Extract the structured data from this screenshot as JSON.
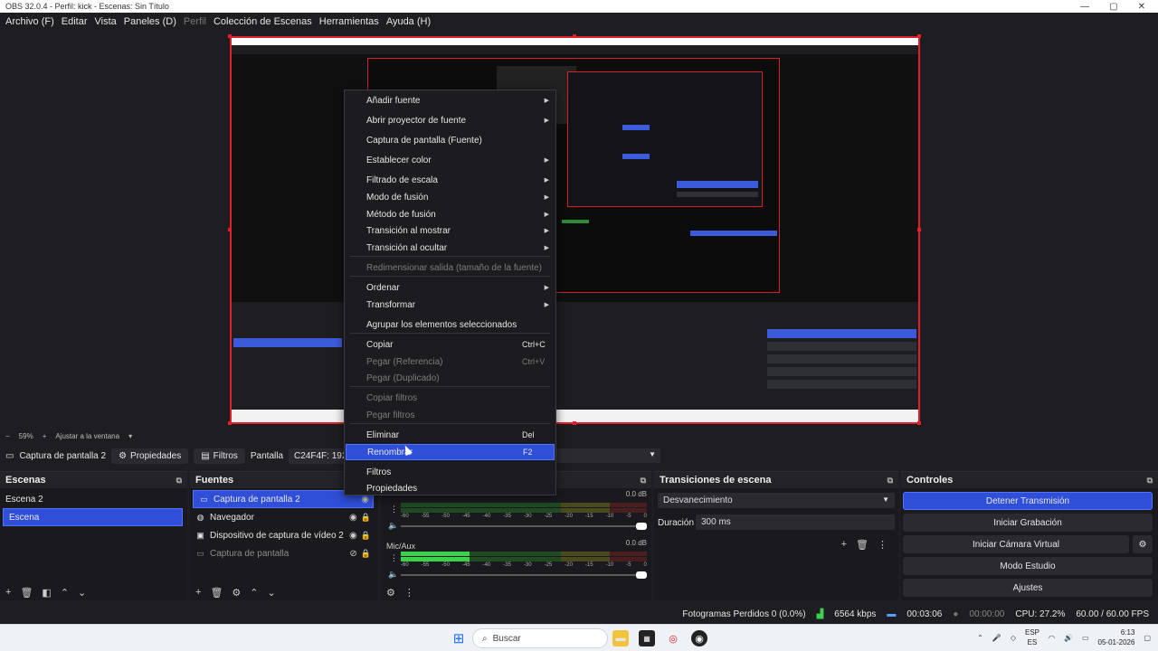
{
  "window": {
    "title": "OBS 32.0.4 - Perfil: kick - Escenas: Sin Título",
    "controls": [
      "—",
      "▢",
      "✕"
    ]
  },
  "menubar": {
    "items": [
      "Archivo (F)",
      "Editar",
      "Vista",
      "Paneles (D)",
      "Perfil",
      "Colección de Escenas",
      "Herramientas",
      "Ayuda (H)"
    ]
  },
  "zoom": {
    "minus": "−",
    "value": "59%",
    "plus": "+",
    "fit": "Ajustar a la ventana"
  },
  "source_bar": {
    "source_name": "Captura de pantalla 2",
    "properties": "Propiedades",
    "filters": "Filtros",
    "screen_label": "Pantalla",
    "screen_value": "C24F4F: 192"
  },
  "scenes": {
    "title": "Escenas",
    "items": [
      {
        "label": "Escena 2",
        "selected": false
      },
      {
        "label": "Escena",
        "selected": true
      }
    ]
  },
  "sources": {
    "title": "Fuentes",
    "items": [
      {
        "label": "Captura de pantalla 2",
        "selected": true
      },
      {
        "label": "Navegador",
        "selected": false
      },
      {
        "label": "Dispositivo de captura de vídeo 2",
        "selected": false
      },
      {
        "label": "Captura de pantalla",
        "selected": false,
        "dimmed": true
      }
    ]
  },
  "mixer": {
    "channels": [
      {
        "name": "",
        "db": "0.0 dB",
        "level": 0
      },
      {
        "name": "Mic/Aux",
        "db": "0.0 dB",
        "level": 0.28
      }
    ],
    "ticks": [
      "-60",
      "-55",
      "-50",
      "-45",
      "-40",
      "-35",
      "-30",
      "-25",
      "-20",
      "-15",
      "-10",
      "-5",
      "0"
    ]
  },
  "transitions": {
    "title": "Transiciones de escena",
    "selected": "Desvanecimiento",
    "duration_label": "Duración",
    "duration_value": "300 ms"
  },
  "controls": {
    "title": "Controles",
    "buttons": [
      "Detener Transmisión",
      "Iniciar Grabación",
      "Iniciar Cámara Virtual",
      "Modo Estudio",
      "Ajustes"
    ]
  },
  "status": {
    "dropped": "Fotogramas Perdidos 0 (0.0%)",
    "bitrate": "6564 kbps",
    "stream_time": "00:03:06",
    "rec_time": "00:00:00",
    "cpu": "CPU: 27.2%",
    "fps": "60.00 / 60.00 FPS"
  },
  "context_menu": {
    "items": [
      {
        "label": "Añadir fuente",
        "submenu": true
      },
      {
        "label": "Abrir proyector de fuente",
        "submenu": true
      },
      {
        "label": "Captura de pantalla (Fuente)"
      },
      {
        "label": "Establecer color",
        "submenu": true
      },
      {
        "label": "Filtrado de escala",
        "submenu": true
      },
      {
        "label": "Modo de fusión",
        "submenu": true
      },
      {
        "label": "Método de fusión",
        "submenu": true
      },
      {
        "label": "Transición al mostrar",
        "submenu": true
      },
      {
        "label": "Transición al ocultar",
        "submenu": true
      },
      {
        "label": "Redimensionar salida (tamaño de la fuente)",
        "disabled": true
      },
      {
        "label": "Ordenar",
        "submenu": true
      },
      {
        "label": "Transformar",
        "submenu": true
      },
      {
        "label": "Agrupar los elementos seleccionados"
      },
      {
        "label": "Copiar",
        "shortcut": "Ctrl+C"
      },
      {
        "label": "Pegar (Referencia)",
        "shortcut": "Ctrl+V",
        "disabled": true
      },
      {
        "label": "Pegar (Duplicado)",
        "disabled": true
      },
      {
        "label": "Copiar filtros",
        "disabled": true
      },
      {
        "label": "Pegar filtros",
        "disabled": true
      },
      {
        "label": "Eliminar",
        "shortcut": "Del"
      },
      {
        "label": "Renombrar",
        "shortcut": "F2",
        "highlighted": true
      },
      {
        "label": "Filtros"
      },
      {
        "label": "Propiedades"
      }
    ]
  },
  "taskbar": {
    "search_placeholder": "Buscar",
    "lang_top": "ESP",
    "lang_bottom": "ES",
    "time": "6:13",
    "date": "05-01-2026"
  },
  "colors": {
    "accent": "#2f4fd8",
    "selection_border": "#e0202a",
    "meter_green": "#3cd14a"
  }
}
